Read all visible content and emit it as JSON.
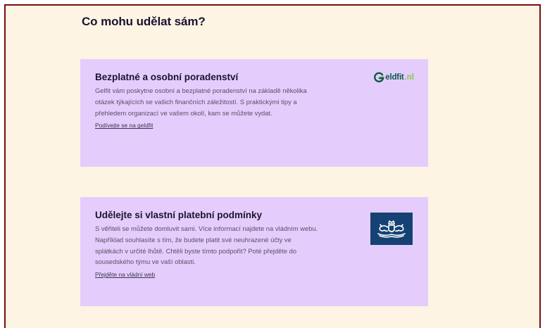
{
  "heading": "Co mohu udělat sám?",
  "cards": [
    {
      "title": "Bezplatné a osobní poradenství",
      "text": "Gelfit vám poskytne osobní a bezplatné poradenství na základě několika otázek týkajících se vašich finančních záležitostí. S praktickými tipy a přehledem organizací ve vašem okolí, kam se můžete vydat.",
      "link": "Podívejte se na geldfit",
      "logo": {
        "icon": "geldfit-g-icon",
        "word": "eldfit",
        "tld": ".nl",
        "colors": {
          "word": "#0b5a48",
          "tld": "#8cc63f"
        }
      }
    },
    {
      "title": "Udělejte si vlastní platební podmínky",
      "text": "S věřiteli se můžete domluvit sami. Více informací najdete na vládním webu. Například souhlasíte s tím, že budete platit své neuhrazené účty ve splátkách v určité lhůtě. Chtěli byste tímto podpořit? Poté přejděte do sousedského týmu ve vaší oblasti.",
      "link": "Přejděte na vládní web",
      "logo": {
        "icon": "government-emblem-icon",
        "colors": {
          "background": "#154273"
        }
      }
    }
  ],
  "colors": {
    "page_background": "#fdf4e3",
    "card_background": "#e4cdfc",
    "frame_border": "#7a0b10"
  }
}
